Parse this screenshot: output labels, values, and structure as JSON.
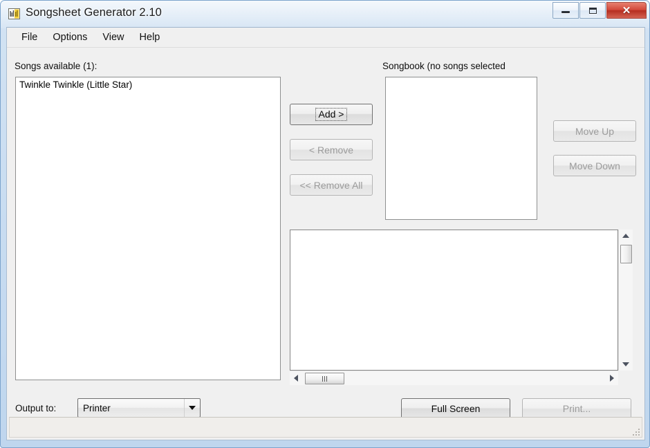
{
  "window": {
    "title": "Songsheet Generator 2.10",
    "app_icon": "songsheet-app-icon",
    "caption": {
      "minimize": "minimize-icon",
      "maximize": "maximize-icon",
      "close": "✕"
    }
  },
  "menubar": {
    "items": [
      {
        "label": "File"
      },
      {
        "label": "Options"
      },
      {
        "label": "View"
      },
      {
        "label": "Help"
      }
    ]
  },
  "available": {
    "label": "Songs available (1):",
    "items": [
      {
        "label": "Twinkle Twinkle (Little Star)"
      }
    ]
  },
  "songbook": {
    "label": "Songbook (no songs selected",
    "items": []
  },
  "transfer_buttons": {
    "add": {
      "label": "Add >",
      "enabled": true,
      "focused": true
    },
    "remove": {
      "label": "< Remove",
      "enabled": false
    },
    "remove_all": {
      "label": "<< Remove All",
      "enabled": false
    }
  },
  "order_buttons": {
    "move_up": {
      "label": "Move Up",
      "enabled": false
    },
    "move_down": {
      "label": "Move Down",
      "enabled": false
    }
  },
  "preview": {
    "content": "",
    "vertical_scrollbar": {
      "up_arrow": "scroll-up-icon",
      "down_arrow": "scroll-down-icon",
      "thumb_position_percent": 2
    },
    "horizontal_scrollbar": {
      "left_arrow": "scroll-left-icon",
      "right_arrow": "scroll-right-icon",
      "thumb_position_percent": 3
    }
  },
  "output": {
    "label": "Output to:",
    "selected": "Printer",
    "options": [
      "Printer"
    ]
  },
  "action_buttons": {
    "full_screen": {
      "label": "Full Screen",
      "enabled": true
    },
    "print": {
      "label": "Print...",
      "enabled": false
    }
  },
  "statusbar": {
    "text": "",
    "grip": "resize-grip-icon"
  },
  "colors": {
    "frame": "#bfd6ee",
    "client_bg": "#f0f0f0",
    "close_button": "#c2392a",
    "listbox_bg": "#ffffff"
  }
}
